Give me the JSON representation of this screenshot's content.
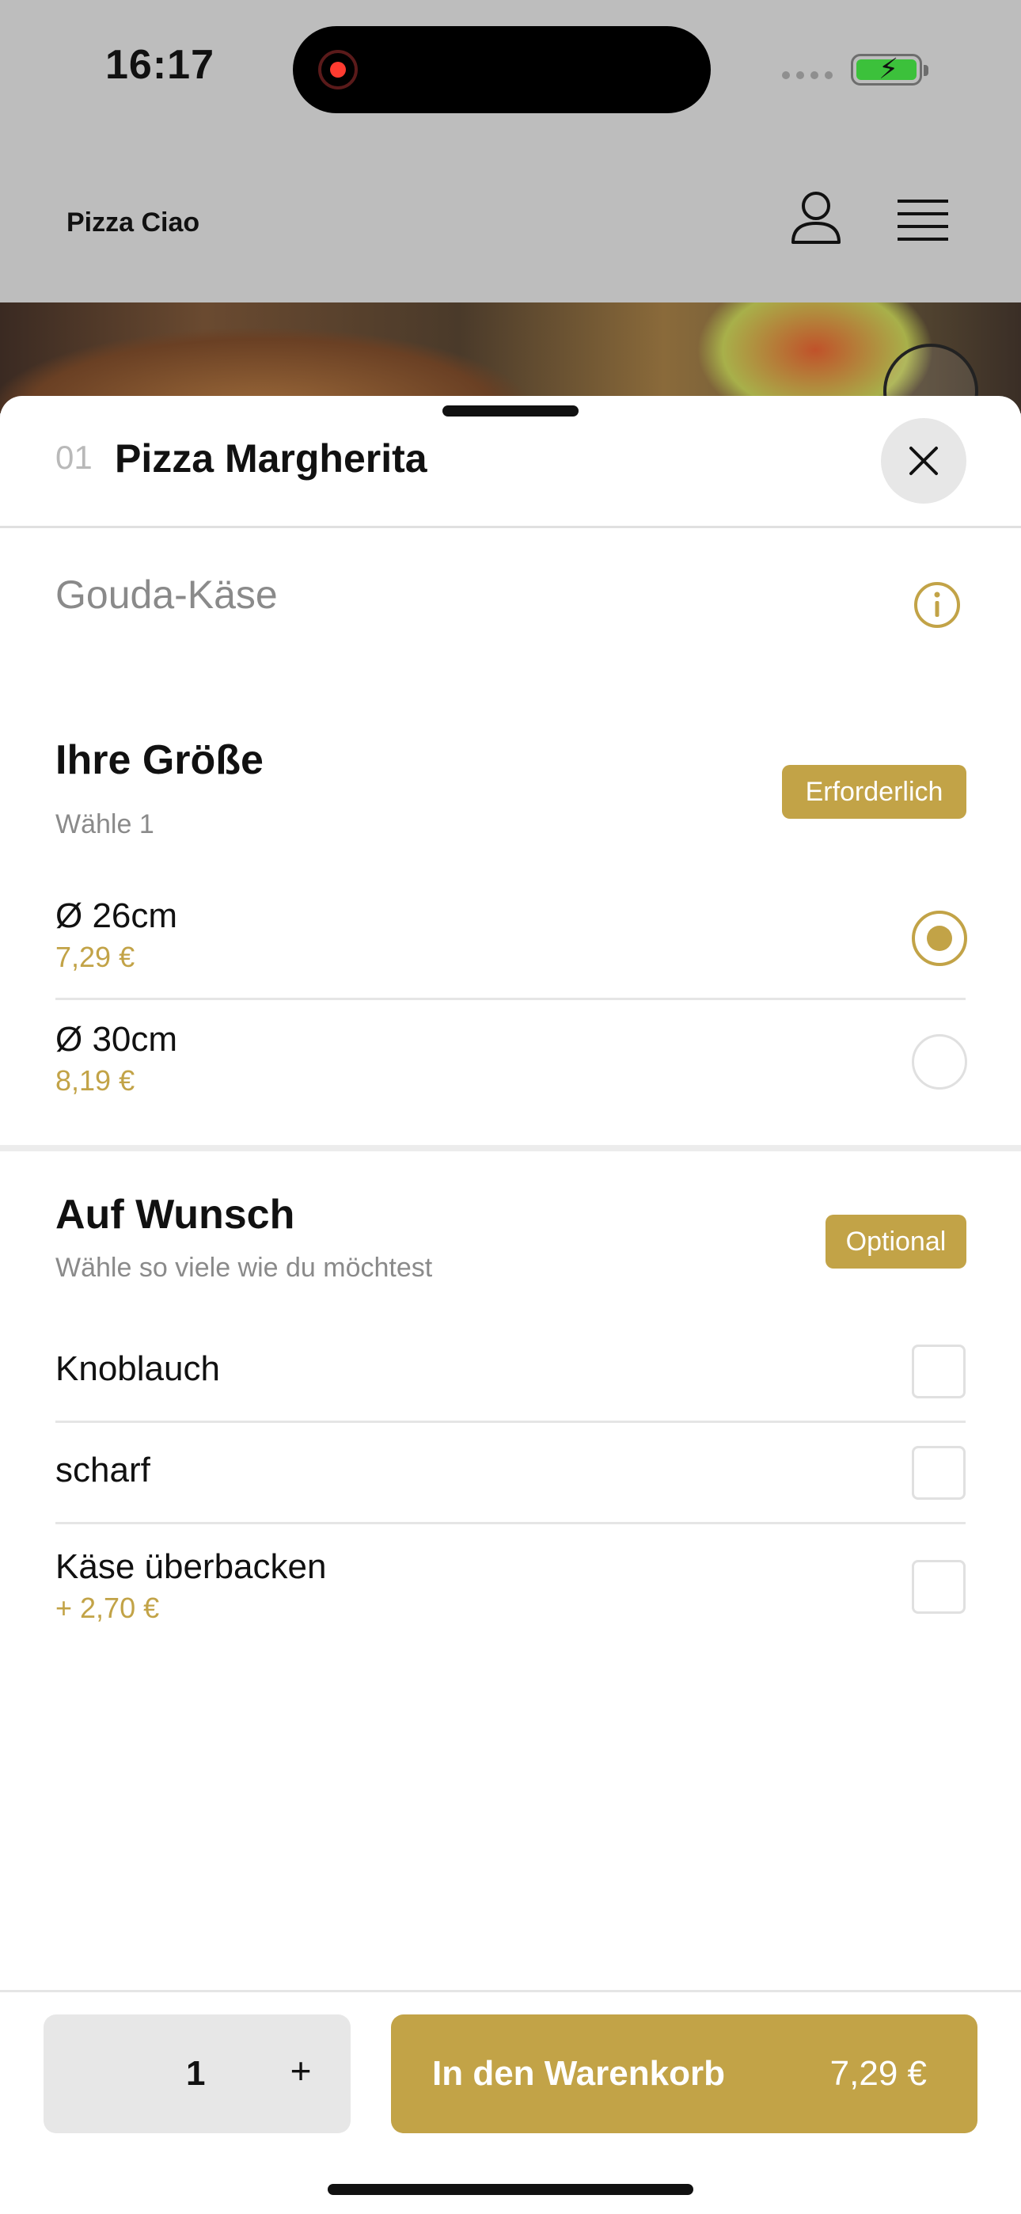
{
  "status_bar": {
    "time": "16:17"
  },
  "header": {
    "brand": "Pizza Ciao"
  },
  "sheet": {
    "item_number": "01",
    "title": "Pizza Margherita",
    "description": "Gouda-Käse"
  },
  "size_section": {
    "title": "Ihre Größe",
    "subtitle": "Wähle 1",
    "badge": "Erforderlich",
    "options": [
      {
        "label": "Ø 26cm",
        "price": "7,29 €",
        "selected": true
      },
      {
        "label": "Ø 30cm",
        "price": "8,19 €",
        "selected": false
      }
    ]
  },
  "extras_section": {
    "title": "Auf Wunsch",
    "subtitle": "Wähle so viele wie du möchtest",
    "badge": "Optional",
    "options": [
      {
        "label": "Knoblauch",
        "price": "",
        "checked": false
      },
      {
        "label": "scharf",
        "price": "",
        "checked": false
      },
      {
        "label": "Käse überbacken",
        "price": "+ 2,70 €",
        "checked": false
      }
    ]
  },
  "footer": {
    "quantity": "1",
    "plus_symbol": "+",
    "add_to_cart_label": "In den Warenkorb",
    "total_price": "7,29 €"
  },
  "colors": {
    "accent": "#c2a347",
    "recording": "#ff3b30",
    "battery": "#3cc13b"
  }
}
